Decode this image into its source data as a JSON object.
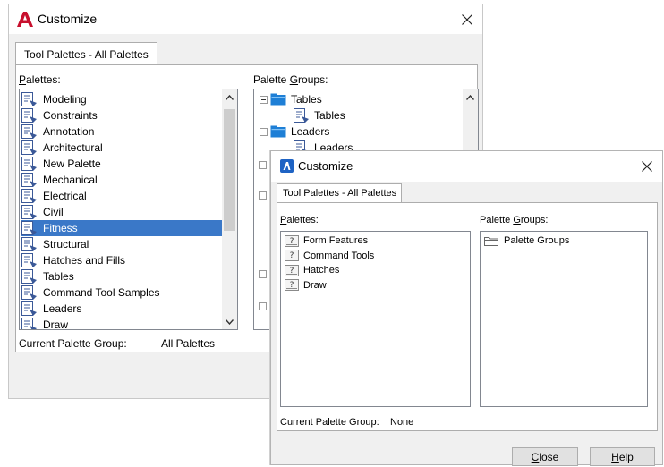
{
  "back_dialog": {
    "title": "Customize",
    "tab_label": "Tool Palettes - All Palettes",
    "palettes_label_u": "P",
    "palettes_label_rest": "alettes:",
    "palettes": [
      "Modeling",
      "Constraints",
      "Annotation",
      "Architectural",
      "New Palette",
      "Mechanical",
      "Electrical",
      "Civil",
      "Fitness",
      "Structural",
      "Hatches and Fills",
      "Tables",
      "Command Tool Samples",
      "Leaders",
      "Draw"
    ],
    "selected_palette": "Fitness",
    "palette_groups_label_a": "Palette ",
    "palette_groups_label_u": "G",
    "palette_groups_label_b": "roups:",
    "groups": [
      {
        "group": "Tables",
        "child": "Tables"
      },
      {
        "group": "Leaders",
        "child": "Leaders"
      }
    ],
    "current_group_label": "Current Palette Group:",
    "current_group_value": "All Palettes"
  },
  "front_dialog": {
    "title": "Customize",
    "tab_label": "Tool Palettes - All Palettes",
    "palettes_label_u": "P",
    "palettes_label_rest": "alettes:",
    "palettes": [
      "Form Features",
      "Command Tools",
      "Hatches",
      "Draw"
    ],
    "palette_groups_label_a": "Palette ",
    "palette_groups_label_u": "G",
    "palette_groups_label_b": "roups:",
    "palette_group_root": "Palette Groups",
    "current_group_label": "Current Palette Group:",
    "current_group_value": "None",
    "close_button_u": "C",
    "close_button_rest": "lose",
    "help_button_u": "H",
    "help_button_rest": "elp"
  },
  "colors": {
    "selection": "#3a78c8",
    "autocad_red": "#c8102e",
    "folder_blue": "#1e7fd6"
  },
  "icons": {
    "back_app": "autocad-logo-icon",
    "front_app": "app-logo-icon",
    "palette": "palette-document-icon",
    "unknown_palette": "question-palette-icon",
    "folder": "folder-icon",
    "close": "close-icon"
  }
}
